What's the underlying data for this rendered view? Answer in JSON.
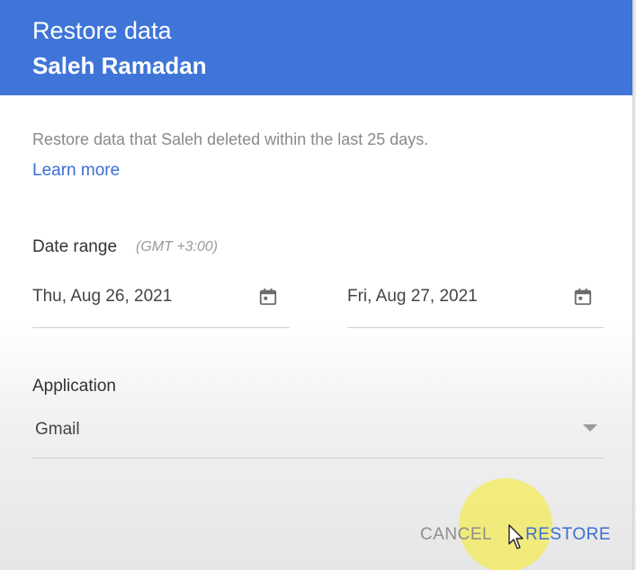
{
  "header": {
    "title": "Restore data",
    "subtitle": "Saleh Ramadan",
    "background_color": "#3f75d8"
  },
  "description": "Restore data that Saleh deleted within the last 25 days.",
  "learn_more": "Learn more",
  "date_range": {
    "label": "Date range",
    "timezone": "(GMT +3:00)",
    "start": {
      "value": "Thu, Aug 26, 2021",
      "icon": "calendar-icon"
    },
    "end": {
      "value": "Fri, Aug 27, 2021",
      "icon": "calendar-icon"
    }
  },
  "application": {
    "label": "Application",
    "selected": "Gmail",
    "icon": "dropdown-arrow-icon"
  },
  "actions": {
    "cancel": "CANCEL",
    "restore": "RESTORE",
    "accent_color": "#3b6fd4"
  },
  "cursor": {
    "icon": "mouse-pointer-icon",
    "highlight_color": "#f4ec50"
  }
}
